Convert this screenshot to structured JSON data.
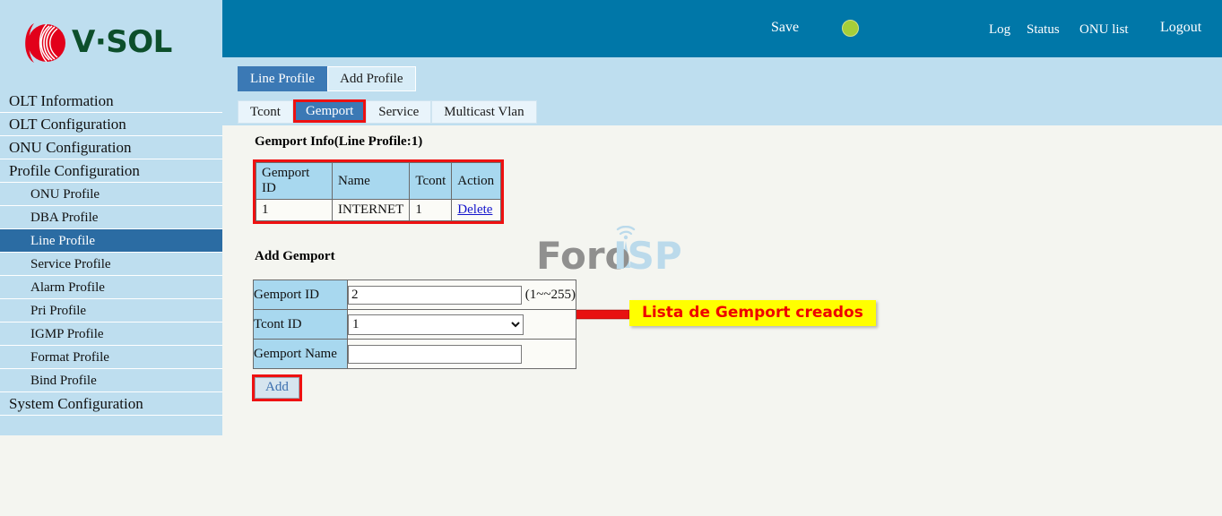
{
  "brand": {
    "name": "V·SOL",
    "logo_icon": "vsol-swirl-logo",
    "text_color": "#0d4f2b",
    "mark_color": "#e2001a"
  },
  "header": {
    "save_label": "Save",
    "status_dot_icon": "green-status-dot",
    "status_dot_color": "#a6ce39",
    "links": [
      {
        "label": "Log"
      },
      {
        "label": "Status"
      },
      {
        "label": "ONU list"
      },
      {
        "label": "Logout"
      }
    ]
  },
  "sidebar": {
    "items": [
      {
        "label": "OLT Information",
        "level": "top",
        "active": false
      },
      {
        "label": "OLT Configuration",
        "level": "top",
        "active": false
      },
      {
        "label": "ONU Configuration",
        "level": "top",
        "active": false
      },
      {
        "label": "Profile Configuration",
        "level": "top",
        "active": false
      },
      {
        "label": "ONU Profile",
        "level": "sub",
        "active": false
      },
      {
        "label": "DBA Profile",
        "level": "sub",
        "active": false
      },
      {
        "label": "Line Profile",
        "level": "sub",
        "active": true
      },
      {
        "label": "Service Profile",
        "level": "sub",
        "active": false
      },
      {
        "label": "Alarm Profile",
        "level": "sub",
        "active": false
      },
      {
        "label": "Pri Profile",
        "level": "sub",
        "active": false
      },
      {
        "label": "IGMP Profile",
        "level": "sub",
        "active": false
      },
      {
        "label": "Format Profile",
        "level": "sub",
        "active": false
      },
      {
        "label": "Bind Profile",
        "level": "sub",
        "active": false
      },
      {
        "label": "System Configuration",
        "level": "top",
        "active": false
      }
    ]
  },
  "tabs_primary": [
    {
      "label": "Line Profile",
      "active": true
    },
    {
      "label": "Add Profile",
      "active": false
    }
  ],
  "tabs_secondary": [
    {
      "label": "Tcont",
      "active": false
    },
    {
      "label": "Gemport",
      "active": true
    },
    {
      "label": "Service",
      "active": false
    },
    {
      "label": "Multicast Vlan",
      "active": false
    }
  ],
  "main": {
    "info_title": "Gemport Info(Line Profile:1)",
    "info_table": {
      "headers": [
        "Gemport ID",
        "Name",
        "Tcont",
        "Action"
      ],
      "rows": [
        {
          "gemport_id": "1",
          "name": "INTERNET",
          "tcont": "1",
          "action": "Delete"
        }
      ]
    },
    "annotation": {
      "text": "Lista de Gemport creados",
      "background": "#ffff00",
      "text_color": "#ee0000",
      "arrow_icon": "left-arrow"
    },
    "watermark": {
      "text_part1": "Foro",
      "text_part2": "ISP",
      "color1": "#6f6f6f",
      "color2": "#a8d2ea"
    },
    "add_title": "Add Gemport",
    "add_form": {
      "gemport_id_label": "Gemport ID",
      "gemport_id_value": "2",
      "gemport_id_hint": "(1~~255)",
      "tcont_id_label": "Tcont ID",
      "tcont_id_value": "1",
      "tcont_id_options": [
        "1"
      ],
      "gemport_name_label": "Gemport Name",
      "gemport_name_value": "",
      "gemport_name_placeholder": ""
    },
    "add_button_label": "Add"
  }
}
